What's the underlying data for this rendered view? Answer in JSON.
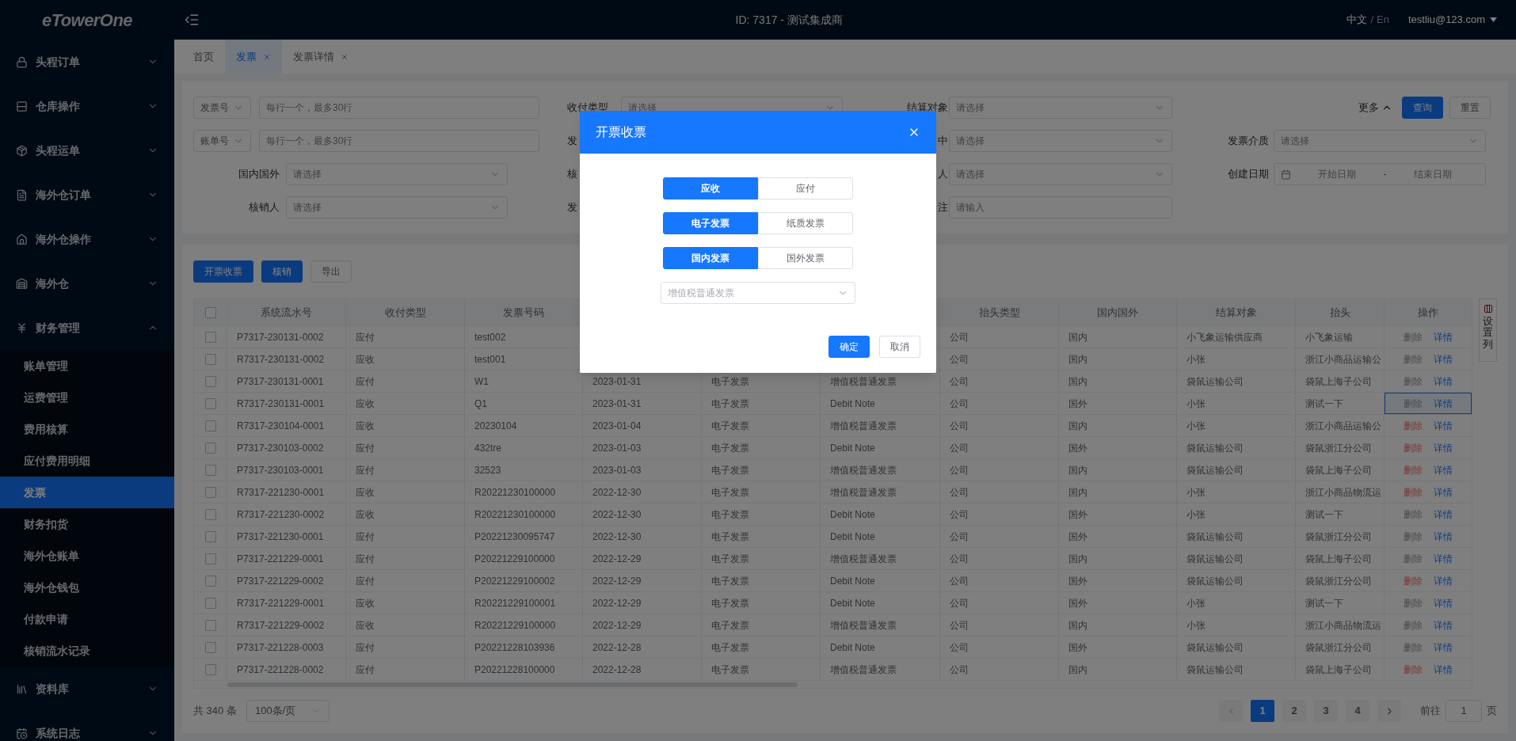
{
  "header": {
    "logo": "eTowerOne",
    "center": "ID: 7317 - 测试集成商",
    "language": {
      "options": [
        {
          "label": "中文",
          "selected": true
        },
        {
          "label": "En",
          "selected": false
        }
      ],
      "separator": "/"
    },
    "user": "testliu@123.com"
  },
  "sidebar": [
    {
      "label": "头程订单",
      "expanded": false
    },
    {
      "label": "仓库操作",
      "expanded": false
    },
    {
      "label": "头程运单",
      "expanded": false
    },
    {
      "label": "海外仓订单",
      "expanded": false
    },
    {
      "label": "海外仓操作",
      "expanded": false
    },
    {
      "label": "海外仓",
      "expanded": false
    },
    {
      "label": "财务管理",
      "expanded": true,
      "children": [
        {
          "label": "账单管理",
          "selected": false
        },
        {
          "label": "运费管理",
          "selected": false
        },
        {
          "label": "费用核算",
          "selected": false
        },
        {
          "label": "应付费用明细",
          "selected": false
        },
        {
          "label": "发票",
          "selected": true
        },
        {
          "label": "财务扣货",
          "selected": false
        },
        {
          "label": "海外仓账单",
          "selected": false
        },
        {
          "label": "海外仓钱包",
          "selected": false
        },
        {
          "label": "付款申请",
          "selected": false
        },
        {
          "label": "核销流水记录",
          "selected": false
        }
      ]
    },
    {
      "label": "资料库",
      "expanded": false
    },
    {
      "label": "系统日志",
      "expanded": false
    }
  ],
  "tabs": [
    {
      "label": "首页",
      "selected": false,
      "closable": false
    },
    {
      "label": "发票",
      "selected": true,
      "closable": true
    },
    {
      "label": "发票详情",
      "selected": false,
      "closable": true
    }
  ],
  "filters": [
    [
      {
        "kind": "select_textarea",
        "select_value": "发票号",
        "placeholder": "每行一个，最多30行"
      },
      {
        "kind": "select",
        "label": "收付类型",
        "placeholder": "请选择"
      },
      {
        "kind": "select",
        "label": "结算对象",
        "placeholder": "请选择"
      },
      {
        "kind": "actions",
        "more_label": "更多",
        "expanded": true,
        "buttons": [
          {
            "label": "查询",
            "primary": true
          },
          {
            "label": "重置",
            "primary": false
          }
        ]
      }
    ],
    [
      {
        "kind": "select_textarea",
        "select_value": "账单号",
        "placeholder": "每行一个，最多30行"
      },
      {
        "kind": "label",
        "label": "发"
      },
      {
        "kind": "select",
        "label": "中",
        "placeholder": "请选择"
      },
      {
        "kind": "select",
        "label": "发票介质",
        "placeholder": "请选择"
      }
    ],
    [
      {
        "kind": "select",
        "label": "国内国外",
        "placeholder": "请选择"
      },
      {
        "kind": "label",
        "label": "核"
      },
      {
        "kind": "select",
        "label": "人",
        "placeholder": "请选择"
      },
      {
        "kind": "daterange",
        "label": "创建日期",
        "start_placeholder": "开始日期",
        "separator": "-",
        "end_placeholder": "结束日期"
      }
    ],
    [
      {
        "kind": "select",
        "label": "核销人",
        "placeholder": "请选择"
      },
      {
        "kind": "label",
        "label": "发"
      },
      {
        "kind": "input",
        "label": "注",
        "placeholder": "请输入"
      }
    ]
  ],
  "toolbar": [
    {
      "label": "开票收票",
      "primary": true
    },
    {
      "label": "核销",
      "primary": true
    },
    {
      "label": "导出",
      "primary": false
    }
  ],
  "table": {
    "columns": {
      "serial": "系统流水号",
      "type": "收付类型",
      "invoice_no": "发票号码",
      "title_type": "抬头类型",
      "region": "国内国外",
      "party": "结算对象",
      "title": "抬头",
      "actions": "操作"
    },
    "settings_label": "设置列",
    "all_checked": false,
    "rows": [
      {
        "serial": "P7317-230131-0002",
        "type": "应付",
        "invoice_no": "test002",
        "title_type": "公司",
        "region": "国内",
        "party": "小飞象运输供应商",
        "title": "小飞象运输",
        "delete": "删除",
        "detail": "详情",
        "delete_active": false,
        "focused": false,
        "checked": false
      },
      {
        "serial": "R7317-230131-0002",
        "type": "应收",
        "invoice_no": "test001",
        "title_type": "公司",
        "region": "国内",
        "party": "小张",
        "title": "浙江小商品运输公",
        "delete": "删除",
        "detail": "详情",
        "delete_active": false,
        "focused": false,
        "checked": false
      },
      {
        "serial": "P7317-230131-0001",
        "type": "应付",
        "invoice_no": "W1",
        "column_4": "2023-01-31",
        "column_5": "电子发票",
        "column_6": "增值税普通发票",
        "title_type": "公司",
        "region": "国内",
        "party": "袋鼠运输公司",
        "title": "袋鼠上海子公司",
        "delete": "删除",
        "detail": "详情",
        "delete_active": false,
        "focused": false,
        "checked": false
      },
      {
        "serial": "R7317-230131-0001",
        "type": "应收",
        "invoice_no": "Q1",
        "column_4": "2023-01-31",
        "column_5": "电子发票",
        "column_6": "Debit Note",
        "title_type": "公司",
        "region": "国外",
        "party": "小张",
        "title": "测试一下",
        "delete": "删除",
        "detail": "详情",
        "delete_active": false,
        "focused": true,
        "checked": false
      },
      {
        "serial": "R7317-230104-0001",
        "type": "应收",
        "invoice_no": "20230104",
        "column_4": "2023-01-04",
        "column_5": "电子发票",
        "column_6": "增值税普通发票",
        "title_type": "公司",
        "region": "国内",
        "party": "小张",
        "title": "浙江小商品运输公",
        "delete": "删除",
        "detail": "详情",
        "delete_active": true,
        "focused": false,
        "checked": false
      },
      {
        "serial": "P7317-230103-0002",
        "type": "应付",
        "invoice_no": "432tre",
        "column_4": "2023-01-03",
        "column_5": "电子发票",
        "column_6": "Debit Note",
        "title_type": "公司",
        "region": "国外",
        "party": "袋鼠运输公司",
        "title": "袋鼠浙江分公司",
        "delete": "删除",
        "detail": "详情",
        "delete_active": true,
        "focused": false,
        "checked": false
      },
      {
        "serial": "P7317-230103-0001",
        "type": "应付",
        "invoice_no": "32523",
        "column_4": "2023-01-03",
        "column_5": "电子发票",
        "column_6": "增值税普通发票",
        "title_type": "公司",
        "region": "国内",
        "party": "袋鼠运输公司",
        "title": "袋鼠上海子公司",
        "delete": "删除",
        "detail": "详情",
        "delete_active": true,
        "focused": false,
        "checked": false
      },
      {
        "serial": "R7317-221230-0001",
        "type": "应收",
        "invoice_no": "R20221230100000",
        "column_4": "2022-12-30",
        "column_5": "电子发票",
        "column_6": "增值税普通发票",
        "title_type": "公司",
        "region": "国内",
        "party": "小张",
        "title": "浙江小商品物流运",
        "delete": "删除",
        "detail": "详情",
        "delete_active": true,
        "focused": false,
        "checked": false
      },
      {
        "serial": "R7317-221230-0002",
        "type": "应收",
        "invoice_no": "R20221230100000",
        "column_4": "2022-12-30",
        "column_5": "电子发票",
        "column_6": "Debit Note",
        "title_type": "公司",
        "region": "国外",
        "party": "小张",
        "title": "测试一下",
        "delete": "删除",
        "detail": "详情",
        "delete_active": false,
        "focused": false,
        "checked": false
      },
      {
        "serial": "P7317-221230-0001",
        "type": "应付",
        "invoice_no": "P20221230095747",
        "column_4": "2022-12-30",
        "column_5": "电子发票",
        "column_6": "Debit Note",
        "title_type": "公司",
        "region": "国外",
        "party": "袋鼠运输公司",
        "title": "袋鼠浙江分公司",
        "delete": "删除",
        "detail": "详情",
        "delete_active": false,
        "focused": false,
        "checked": false
      },
      {
        "serial": "P7317-221229-0001",
        "type": "应付",
        "invoice_no": "P20221229100000",
        "column_4": "2022-12-29",
        "column_5": "电子发票",
        "column_6": "增值税普通发票",
        "title_type": "公司",
        "region": "国内",
        "party": "袋鼠运输公司",
        "title": "袋鼠上海子公司",
        "delete": "删除",
        "detail": "详情",
        "delete_active": false,
        "focused": false,
        "checked": false
      },
      {
        "serial": "P7317-221229-0002",
        "type": "应付",
        "invoice_no": "P20221229100002",
        "column_4": "2022-12-29",
        "column_5": "电子发票",
        "column_6": "Debit Note",
        "title_type": "公司",
        "region": "国外",
        "party": "袋鼠运输公司",
        "title": "袋鼠浙江分公司",
        "delete": "删除",
        "detail": "详情",
        "delete_active": true,
        "focused": false,
        "checked": false
      },
      {
        "serial": "R7317-221229-0001",
        "type": "应收",
        "invoice_no": "R20221229100001",
        "column_4": "2022-12-29",
        "column_5": "电子发票",
        "column_6": "Debit Note",
        "title_type": "公司",
        "region": "国外",
        "party": "小张",
        "title": "测试一下",
        "delete": "删除",
        "detail": "详情",
        "delete_active": false,
        "focused": false,
        "checked": false
      },
      {
        "serial": "R7317-221229-0002",
        "type": "应收",
        "invoice_no": "R20221229100000",
        "column_4": "2022-12-29",
        "column_5": "电子发票",
        "column_6": "增值税普通发票",
        "title_type": "公司",
        "region": "国内",
        "party": "小张",
        "title": "浙江小商品物流运",
        "delete": "删除",
        "detail": "详情",
        "delete_active": false,
        "focused": false,
        "checked": false
      },
      {
        "serial": "P7317-221228-0003",
        "type": "应付",
        "invoice_no": "P20221228103936",
        "column_4": "2022-12-28",
        "column_5": "电子发票",
        "column_6": "Debit Note",
        "title_type": "公司",
        "region": "国外",
        "party": "袋鼠运输公司",
        "title": "袋鼠浙江分公司",
        "delete": "删除",
        "detail": "详情",
        "delete_active": false,
        "focused": false,
        "checked": false
      },
      {
        "serial": "P7317-221228-0002",
        "type": "应付",
        "invoice_no": "P20221228100000",
        "column_4": "2022-12-28",
        "column_5": "电子发票",
        "column_6": "增值税普通发票",
        "title_type": "公司",
        "region": "国内",
        "party": "袋鼠运输公司",
        "title": "袋鼠上海子公司",
        "delete": "删除",
        "detail": "详情",
        "delete_active": true,
        "focused": false,
        "checked": false
      }
    ]
  },
  "pagination": {
    "total": "共 340 条",
    "page_size": "100条/页",
    "pages": [
      {
        "label": "1",
        "selected": true
      },
      {
        "label": "2",
        "selected": false
      },
      {
        "label": "3",
        "selected": false
      },
      {
        "label": "4",
        "selected": false
      }
    ],
    "goto_label": "前往",
    "goto_value": "1",
    "page_suffix": "页"
  },
  "dialog": {
    "title": "开票收票",
    "segment_groups": [
      {
        "options": [
          {
            "label": "应收",
            "selected": true
          },
          {
            "label": "应付",
            "selected": false
          }
        ]
      },
      {
        "options": [
          {
            "label": "电子发票",
            "selected": true
          },
          {
            "label": "纸质发票",
            "selected": false
          }
        ]
      },
      {
        "options": [
          {
            "label": "国内发票",
            "selected": true
          },
          {
            "label": "国外发票",
            "selected": false
          }
        ]
      }
    ],
    "select_placeholder": "增值税普通发票",
    "buttons": [
      {
        "label": "确定",
        "primary": true
      },
      {
        "label": "取消",
        "primary": false
      }
    ]
  }
}
